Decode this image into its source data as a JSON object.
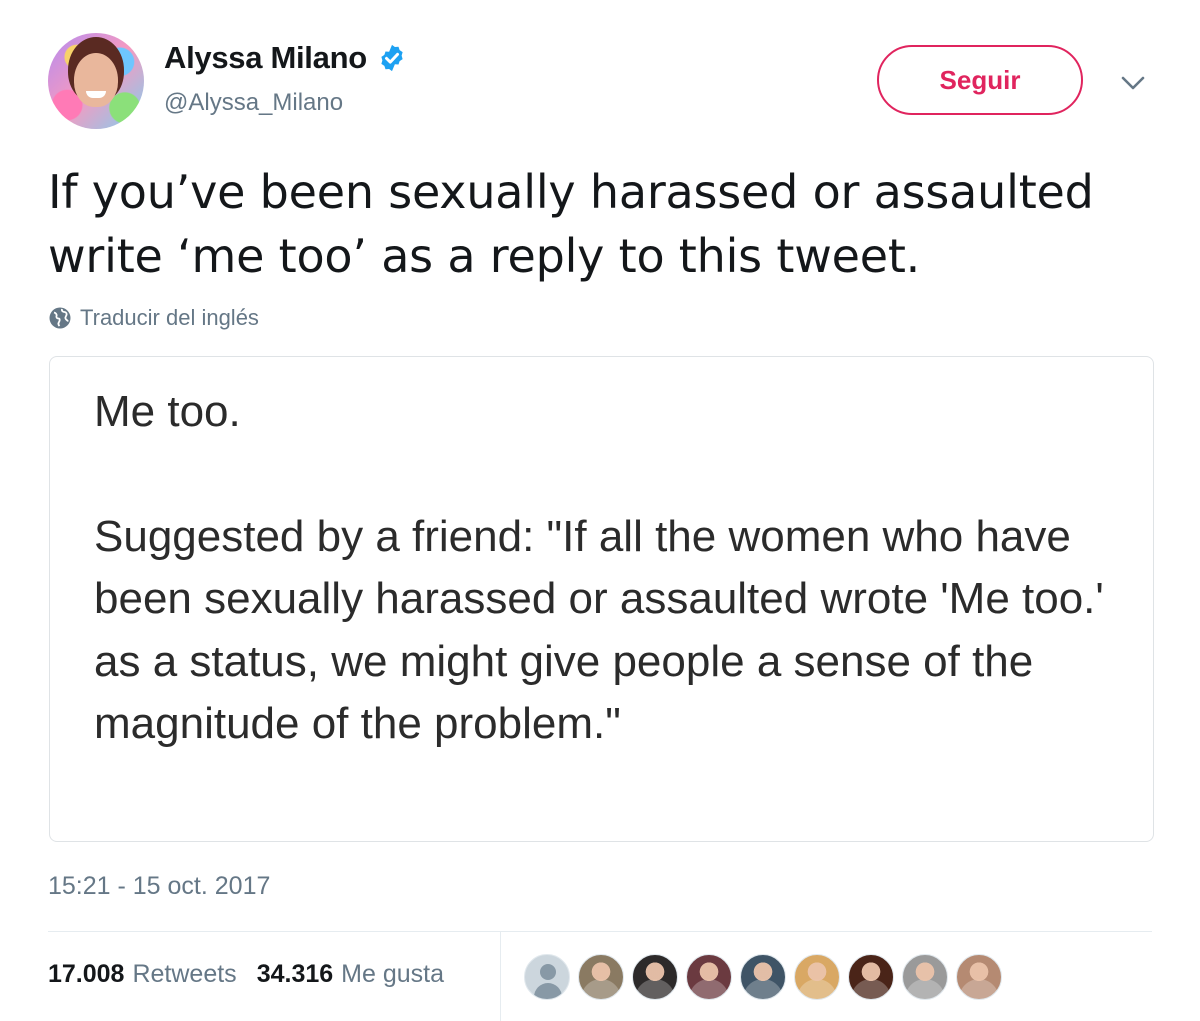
{
  "author": {
    "display_name": "Alyssa Milano",
    "handle": "@Alyssa_Milano",
    "verified_icon": "verified-badge-icon",
    "verified_color": "#1da1f2"
  },
  "follow_button": {
    "label": "Seguir",
    "color": "#e0245e"
  },
  "tweet": {
    "text": "If you’ve been sexually harassed or assaulted write ‘me too’ as a reply to this tweet.",
    "translate_label": "Traducir del inglés",
    "translate_icon": "globe-icon"
  },
  "image_card": {
    "line1": "Me too.",
    "paragraph": "Suggested by a friend: \"If all the women who have been sexually harassed or assaulted wrote 'Me too.' as a status, we might give people a sense of the magnitude of the problem.\""
  },
  "timestamp": "15:21 - 15 oct. 2017",
  "stats": {
    "retweets_count": "17.008",
    "retweets_label": "Retweets",
    "likes_count": "34.316",
    "likes_label": "Me gusta"
  },
  "likers": [
    {
      "kind": "default-avatar",
      "color": "#ccd6dd"
    },
    {
      "kind": "photo",
      "color": "#8a7a62"
    },
    {
      "kind": "photo",
      "color": "#2d2a2a"
    },
    {
      "kind": "photo",
      "color": "#6b3a40"
    },
    {
      "kind": "photo",
      "color": "#3f5466"
    },
    {
      "kind": "photo",
      "color": "#d9a864"
    },
    {
      "kind": "photo",
      "color": "#4a2418"
    },
    {
      "kind": "photo",
      "color": "#9a9a9a"
    },
    {
      "kind": "photo",
      "color": "#b58a72"
    }
  ]
}
